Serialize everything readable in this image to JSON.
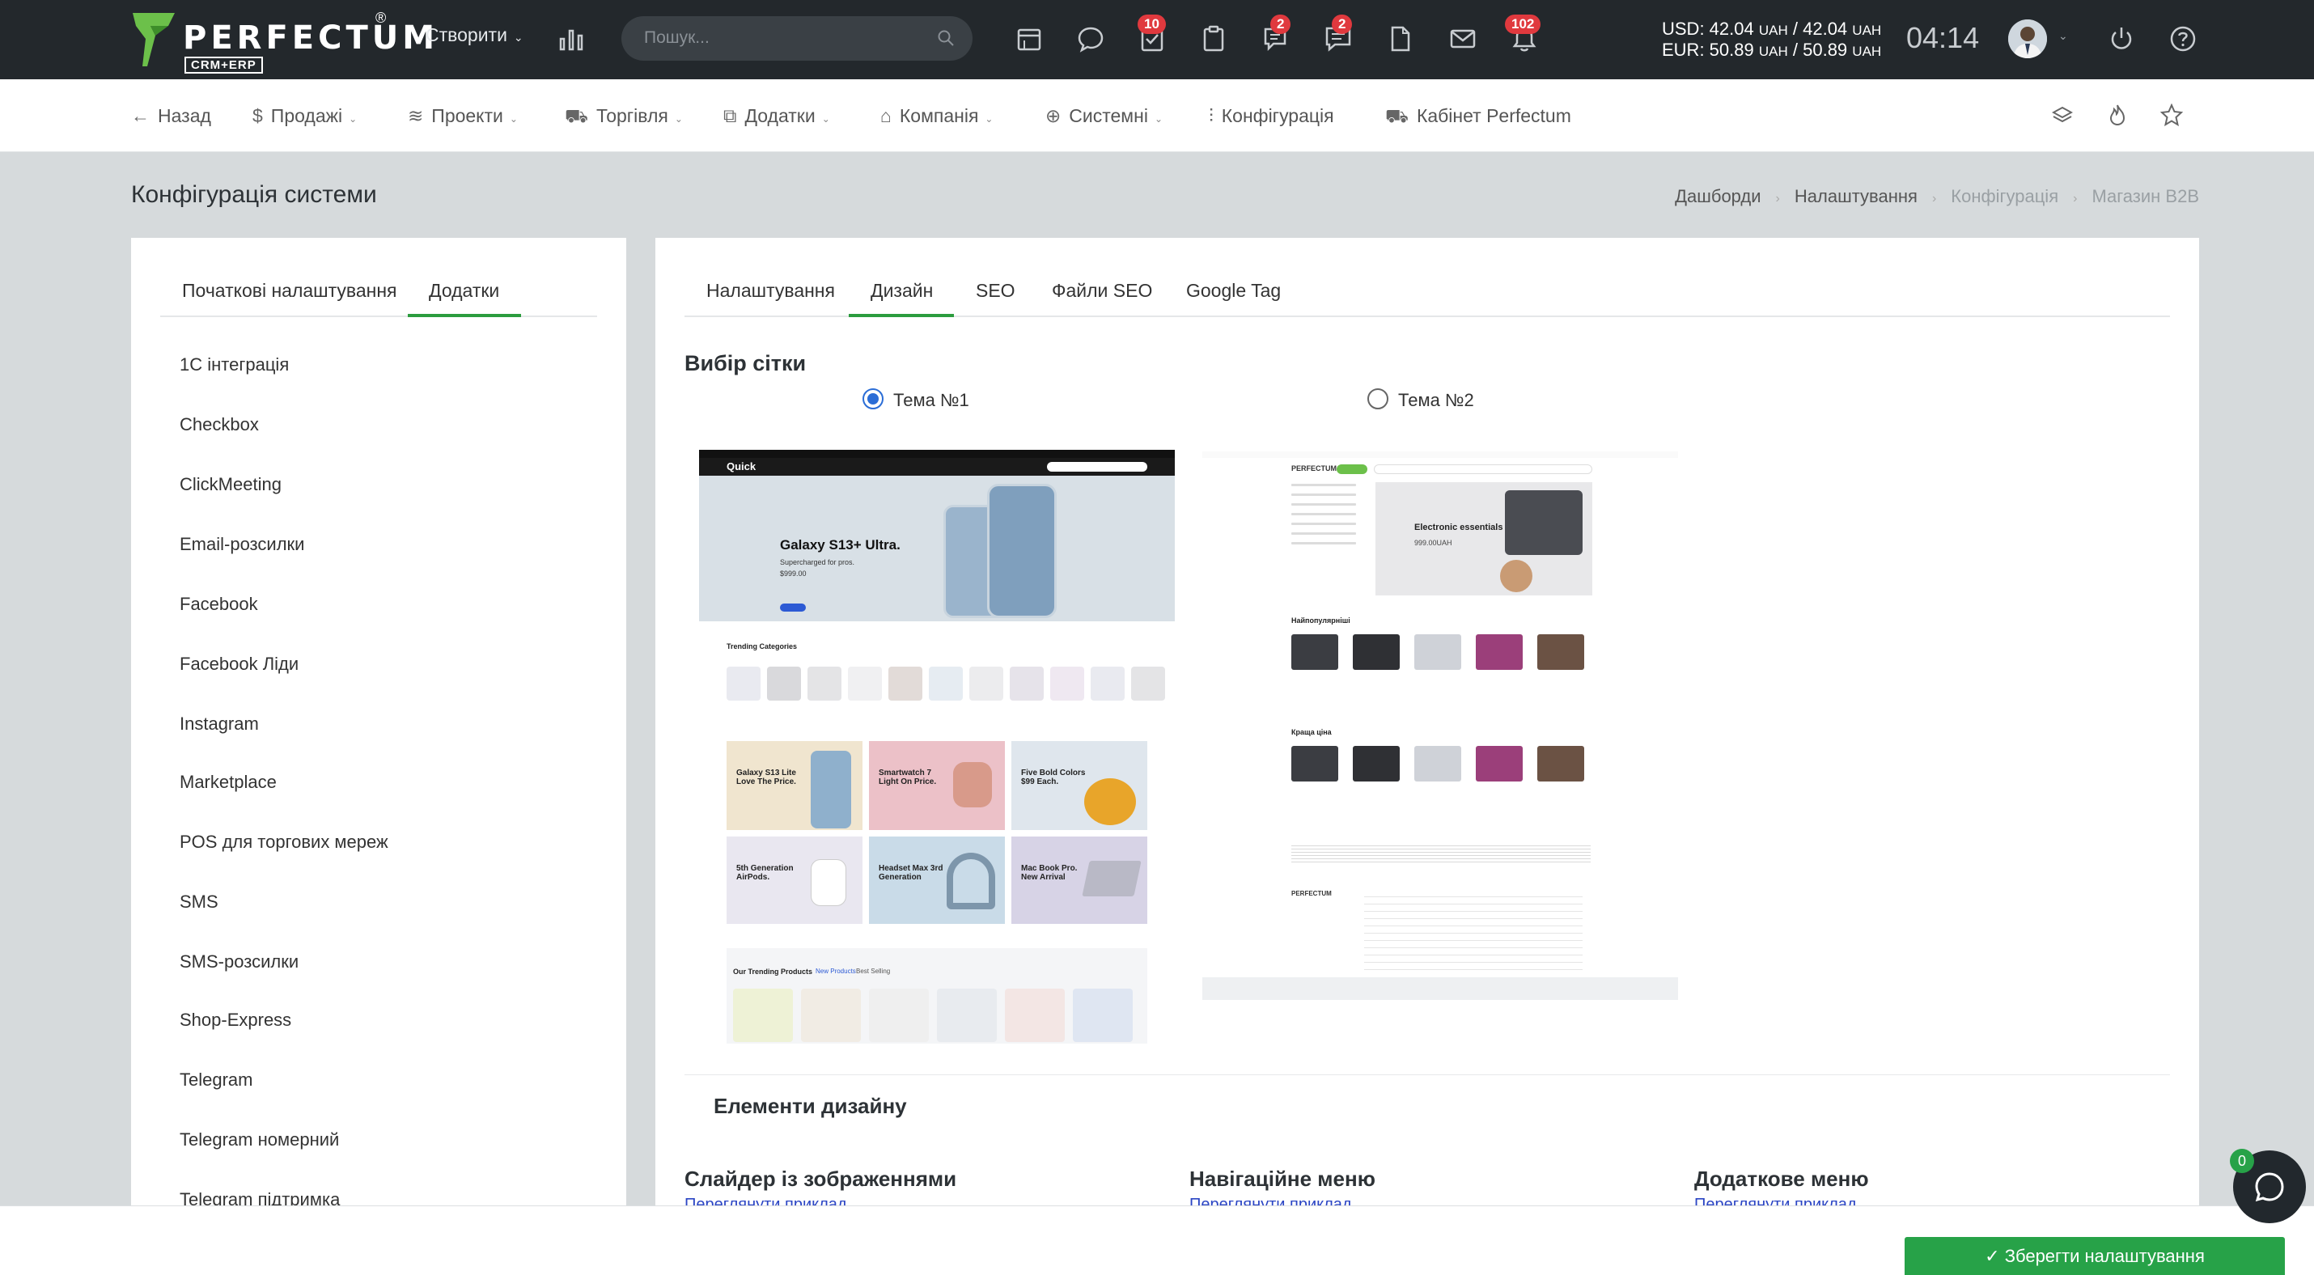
{
  "topbar": {
    "logo_word": "PERFECTUM",
    "logo_sub": "CRM+ERP",
    "logo_reg": "®",
    "create_label": "Створити",
    "search_placeholder": "Пошук...",
    "badges": {
      "tasks": "10",
      "chat": "2",
      "messages": "2",
      "notifications": "102"
    },
    "usd_line": "USD: 42.04",
    "usd_unit1": "UAH",
    "usd_mid": "/ 42.04",
    "usd_unit2": "UAH",
    "eur_line": "EUR: 50.89",
    "eur_unit1": "UAH",
    "eur_mid": "/ 50.89",
    "eur_unit2": "UAH",
    "time": "04:14"
  },
  "subnav": {
    "back": "Назад",
    "sales": "Продажі",
    "projects": "Проекти",
    "trade": "Торгівля",
    "addons": "Додатки",
    "company": "Компанія",
    "system": "Системні",
    "config": "Конфігурація",
    "cabinet": "Кабінет Perfectum"
  },
  "page": {
    "title": "Конфігурація системи",
    "breadcrumb": [
      "Дашборди",
      "Налаштування",
      "Конфігурація",
      "Магазин B2B"
    ]
  },
  "left": {
    "tabs": [
      "Початкові налаштування",
      "Додатки"
    ],
    "items": [
      "1C інтеграція",
      "Checkbox",
      "ClickMeeting",
      "Email-розсилки",
      "Facebook",
      "Facebook Ліди",
      "Instagram",
      "Marketplace",
      "POS для торгових мереж",
      "SMS",
      "SMS-розсилки",
      "Shop-Express",
      "Telegram",
      "Telegram номерний",
      "Telegram підтримка"
    ]
  },
  "right": {
    "tabs": [
      "Налаштування",
      "Дизайн",
      "SEO",
      "Файли SEO",
      "Google Tag"
    ],
    "grid_title": "Вибір сітки",
    "theme1_label": "Тема №1",
    "theme2_label": "Тема №2",
    "theme1_selected": true,
    "design_elements_title": "Елементи дизайну",
    "columns": [
      {
        "title": "Слайдер із зображеннями",
        "link": "Переглянути приклад"
      },
      {
        "title": "Навігаційне меню",
        "link": "Переглянути приклад"
      },
      {
        "title": "Додаткове меню",
        "link": "Переглянути приклад"
      }
    ]
  },
  "preview1": {
    "brand": "Quick",
    "hero_title": "Galaxy S13+ Ultra.",
    "hero_sub": "Supercharged for pros.",
    "hero_price": "$999.00",
    "trending": "Trending Categories",
    "promo": [
      "Galaxy S13 Lite Love The Price.",
      "Smartwatch 7 Light On Price.",
      "Five Bold Colors $99 Each.",
      "5th Generation AirPods.",
      "Headset Max 3rd Generation",
      "Mac Book Pro. New Arrival"
    ],
    "products_title": "Our Trending Products",
    "products_tabs": [
      "New Products",
      "Best Selling"
    ]
  },
  "preview2": {
    "brand": "PERFECTUM",
    "hero_title": "Electronic essentials",
    "hero_price": "999.00UAH",
    "popular": "Найпопулярніші",
    "best_price": "Краща ціна"
  },
  "footer": {
    "save": "Зберегти налаштування",
    "chat_count": "0"
  },
  "colors": {
    "accent_green": "#27a248",
    "topbar": "#23282c",
    "badge_red": "#e0393e",
    "radio_blue": "#2b6dd6"
  }
}
